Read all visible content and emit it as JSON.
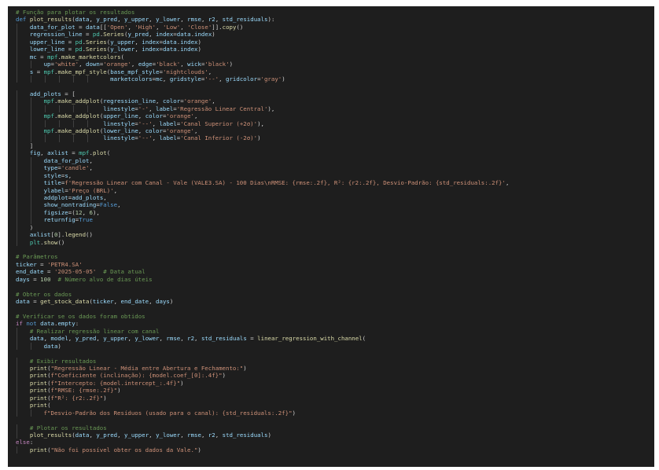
{
  "editor": {
    "theme": "dark",
    "colors": {
      "background": "#1e1e1e",
      "comment": "#6a9955",
      "keyword": "#569cd6",
      "control": "#c586c0",
      "function": "#dcdcaa",
      "string": "#ce9178",
      "number": "#b5cea8",
      "variable": "#9cdcfe"
    },
    "lines": [
      "# Função para plotar os resultados",
      "def plot_results(data, y_pred, y_upper, y_lower, rmse, r2, std_residuals):",
      "    data_for_plot = data[['Open', 'High', 'Low', 'Close']].copy()",
      "    regression_line = pd.Series(y_pred, index=data.index)",
      "    upper_line = pd.Series(y_upper, index=data.index)",
      "    lower_line = pd.Series(y_lower, index=data.index)",
      "    mc = mpf.make_marketcolors(",
      "        up='white', down='orange', edge='black', wick='black')",
      "    s = mpf.make_mpf_style(base_mpf_style='nightclouds',",
      "                           marketcolors=mc, gridstyle='--', gridcolor='gray')",
      "",
      "    add_plots = [",
      "        mpf.make_addplot(regression_line, color='orange',",
      "                         linestyle='-', label='Regressão Linear Central'),",
      "        mpf.make_addplot(upper_line, color='orange',",
      "                         linestyle='--', label='Canal Superior (+2σ)'),",
      "        mpf.make_addplot(lower_line, color='orange',",
      "                         linestyle='--', label='Canal Inferior (-2σ)')",
      "    ]",
      "    fig, axlist = mpf.plot(",
      "        data_for_plot,",
      "        type='candle',",
      "        style=s,",
      "        title=f'Regressão Linear com Canal - Vale (VALE3.SA) - 100 Dias\\nRMSE: {rmse:.2f}, R²: {r2:.2f}, Desvio-Padrão: {std_residuals:.2f}',",
      "        ylabel='Preço (BRL)',",
      "        addplot=add_plots,",
      "        show_nontrading=False,",
      "        figsize=(12, 6),",
      "        returnfig=True",
      "    )",
      "    axlist[0].legend()",
      "    plt.show()",
      "",
      "# Parâmetros",
      "ticker = 'PETR4.SA'",
      "end_date = '2025-05-05'  # Data atual",
      "days = 100  # Número alvo de dias úteis",
      "",
      "# Obter os dados",
      "data = get_stock_data(ticker, end_date, days)",
      "",
      "# Verificar se os dados foram obtidos",
      "if not data.empty:",
      "    # Realizar regressão linear com canal",
      "    data, model, y_pred, y_upper, y_lower, rmse, r2, std_residuals = linear_regression_with_channel(",
      "        data)",
      "",
      "    # Exibir resultados",
      "    print(\"Regressão Linear - Média entre Abertura e Fechamento:\")",
      "    print(f\"Coeficiente (inclinação): {model.coef_[0]:.4f}\")",
      "    print(f\"Intercepto: {model.intercept_:.4f}\")",
      "    print(f\"RMSE: {rmse:.2f}\")",
      "    print(f\"R²: {r2:.2f}\")",
      "    print(",
      "        f\"Desvio-Padrão dos Resíduos (usado para o canal): {std_residuals:.2f}\")",
      "",
      "    # Plotar os resultados",
      "    plot_results(data, y_pred, y_upper, y_lower, rmse, r2, std_residuals)",
      "else:",
      "    print(\"Não foi possível obter os dados da Vale.\")"
    ]
  }
}
